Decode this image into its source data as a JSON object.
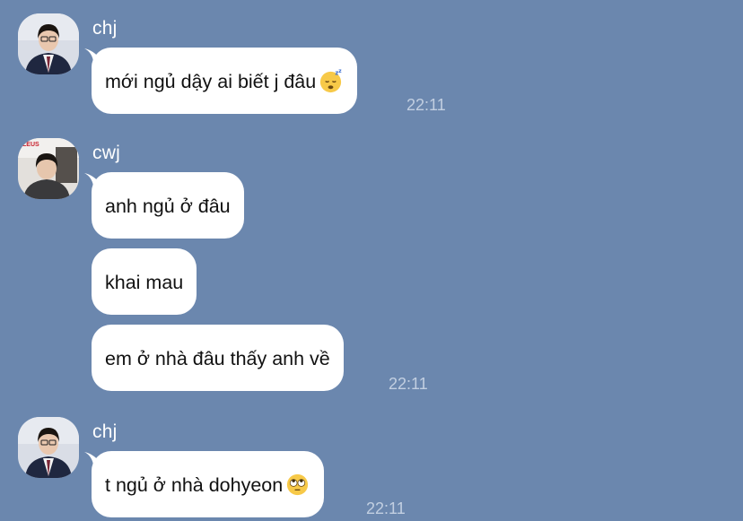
{
  "chat": {
    "groups": [
      {
        "sender": "chj",
        "messages": [
          {
            "text": "mới ngủ dậy ai biết j đâu",
            "emoji": "sleeping-face-emoji",
            "time": "22:11"
          }
        ]
      },
      {
        "sender": "cwj",
        "avatar_overlay_text": "ZEUS",
        "messages": [
          {
            "text": "anh ngủ ở đâu",
            "time": ""
          },
          {
            "text": "khai mau",
            "time": ""
          },
          {
            "text": "em ở nhà đâu thấy anh về",
            "time": "22:11"
          }
        ]
      },
      {
        "sender": "chj",
        "messages": [
          {
            "text": "t ngủ ở nhà dohyeon",
            "emoji": "face-with-rolling-eyes-emoji",
            "time": "22:11"
          }
        ]
      }
    ]
  },
  "colors": {
    "background": "#6b87ae",
    "bubble": "#ffffff",
    "timestamp": "#c2cfe1",
    "sender_name": "#ffffff"
  }
}
